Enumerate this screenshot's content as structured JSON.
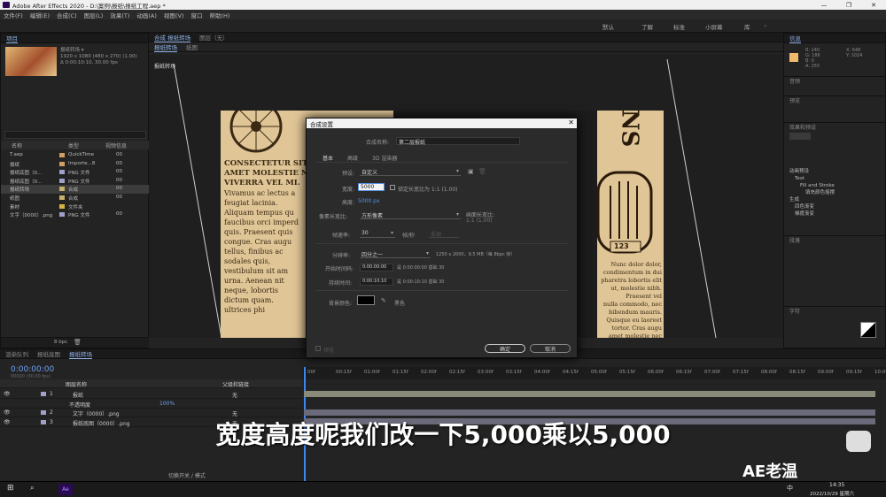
{
  "window": {
    "title": "Adobe After Effects 2020 - D:\\案例\\报纸\\报纸工程.aep *",
    "min": "—",
    "max": "❐",
    "close": "✕"
  },
  "menu": [
    "文件(F)",
    "编辑(E)",
    "合成(C)",
    "图层(L)",
    "效果(T)",
    "动画(A)",
    "视图(V)",
    "窗口",
    "帮助(H)"
  ],
  "workspaces": [
    "默认",
    "了解",
    "标准",
    "小屏幕",
    "库"
  ],
  "project": {
    "tab": "项目",
    "item_name": "报纸转场 ▾",
    "info": [
      "1920 x 1080 (480 x 270) (1.00)",
      "Δ 0:00:10:10, 30.00 fps"
    ],
    "headers": [
      "名称",
      "类型",
      "视频信息"
    ],
    "rows": [
      {
        "name": "T.aep",
        "type": "QuickTime",
        "info": "00",
        "color": "#cfa060"
      },
      {
        "name": "报纸",
        "type": "Importe...8",
        "info": "00",
        "color": "#cfa060"
      },
      {
        "name": "报纸底图（0...",
        "type": "PNG 文件",
        "info": "00",
        "color": "#a0a0cc"
      },
      {
        "name": "报纸底图（0...",
        "type": "PNG 文件",
        "info": "00",
        "color": "#a0a0cc"
      },
      {
        "name": "报纸转场",
        "type": "合成",
        "info": "00",
        "color": "#c8b26a"
      },
      {
        "name": "纸图",
        "type": "合成",
        "info": "00",
        "color": "#c8b26a"
      },
      {
        "name": "素材",
        "type": "文件夹",
        "info": "",
        "color": "#d8b440"
      },
      {
        "name": "文字（0000）.png",
        "type": "PNG 文件",
        "info": "00",
        "color": "#a0a0cc"
      }
    ],
    "footer_bpc": "8 bpc"
  },
  "comp_panel": {
    "tabs": [
      "合成 报纸转场",
      "图层（无）"
    ],
    "subtabs": [
      "报纸转场",
      "纸图"
    ],
    "label": "报纸转场"
  },
  "artwork": {
    "col1": [
      "CONSECTETUR SIT",
      "AMET MOLESTIE NEC",
      "VIVERRA VEL MI.",
      "Vivamus ac lectus a",
      "feugiat lacinia.",
      "Aliquam tempus qu",
      "faucibus orci imperd",
      "quis. Praesent quis",
      "congue. Cras augu",
      "tellus, finibus ac",
      "sodales quis,",
      "vestibulum sit am",
      "urna. Aenean nit",
      "neque, lobortis",
      "dictum quam.",
      "ultrices phi"
    ],
    "col2": [
      "Nunc dolor dolor,",
      "condimentum in dui",
      "pharetra lobortis elit",
      "ut, molestie nibh.",
      "Praesent vel",
      "nulla commodo, nec",
      "bibendum mauris.",
      "Quisque eu laoreet",
      "tortor. Cras augu",
      "amet molestie nec",
      "vivamus ac"
    ],
    "sign": "NS",
    "plate": "123"
  },
  "dialog": {
    "title": "合成设置",
    "close": "✕",
    "name_label": "合成名称:",
    "name_value": "第二层报纸",
    "tabs": [
      "基本",
      "高级",
      "3D 渲染器"
    ],
    "preset_label": "预设:",
    "preset_value": "自定义",
    "width_label": "宽度:",
    "width_value": "5000",
    "lock_label": "锁定长宽比为 1:1 (1.00)",
    "height_label": "高度:",
    "height_value": "5000 px",
    "par_label": "像素长宽比:",
    "par_value": "方形像素",
    "frame_ar_label": "画面长宽比:",
    "frame_ar_value": "1:1 (1.00)",
    "fps_label": "帧速率:",
    "fps_value": "30",
    "fps_unit": "帧/秒",
    "fps_drop": "丢帧",
    "res_label": "分辨率:",
    "res_value": "四分之一",
    "res_info": "1250 x 2000，9.5 MB（每 8bpc 帧）",
    "start_label": "开始时间码:",
    "start_value": "0:00:00:00",
    "start_info": "是 0:00:00:00  基础 30",
    "dur_label": "持续时间:",
    "dur_value": "0:00:10:10",
    "dur_info": "是 0:00:10:10  基础 30",
    "bg_label": "背景颜色:",
    "bg_value": "黑色",
    "preview": "预览",
    "ok": "确定",
    "cancel": "取消"
  },
  "right": {
    "info_tab": "信息",
    "info_vals": [
      "R: 240",
      "G: 186",
      "B: 0",
      "A: 255"
    ],
    "xy": [
      "X: 648",
      "Y: 1024"
    ],
    "sections": [
      "音频",
      "预览",
      "效果和预设",
      "段落",
      "字符"
    ],
    "effects_tree": [
      "动画预设",
      "Text",
      "Fill and Stroke",
      "填充颜色摇摆",
      "生成",
      "四色渐变",
      "梯度渐变"
    ]
  },
  "timeline": {
    "tabs": [
      "渲染队列",
      "报纸底图",
      "报纸转场"
    ],
    "timecode": "0:00:00:00",
    "timecode_sub": "00000 (30.00 fps)",
    "col_headers": [
      "图层名称",
      "父级和链接"
    ],
    "ticks": [
      "00f",
      "00:15f",
      "01:00f",
      "01:15f",
      "02:00f",
      "02:15f",
      "03:00f",
      "03:15f",
      "04:00f",
      "04:15f",
      "05:00f",
      "05:15f",
      "06:00f",
      "06:15f",
      "07:00f",
      "07:15f",
      "08:00f",
      "08:15f",
      "09:00f",
      "09:15f",
      "10:00f"
    ],
    "layers": [
      {
        "num": "1",
        "name": "报纸",
        "parent": "无"
      },
      {
        "num": "",
        "name": "不透明度",
        "parent": "100%"
      },
      {
        "num": "2",
        "name": "文字（0000）.png",
        "parent": "无"
      },
      {
        "num": "3",
        "name": "报纸底图（0000）.png",
        "parent": "无"
      }
    ],
    "footer": "切换开关 / 模式"
  },
  "subtitle": "宽度高度呢我们改一下5,000乘以5,000",
  "watermark": "AE老温",
  "taskbar": {
    "time": "14:35",
    "date": "2022/10/29 星期六",
    "lang": "中",
    "app": "Ae"
  }
}
